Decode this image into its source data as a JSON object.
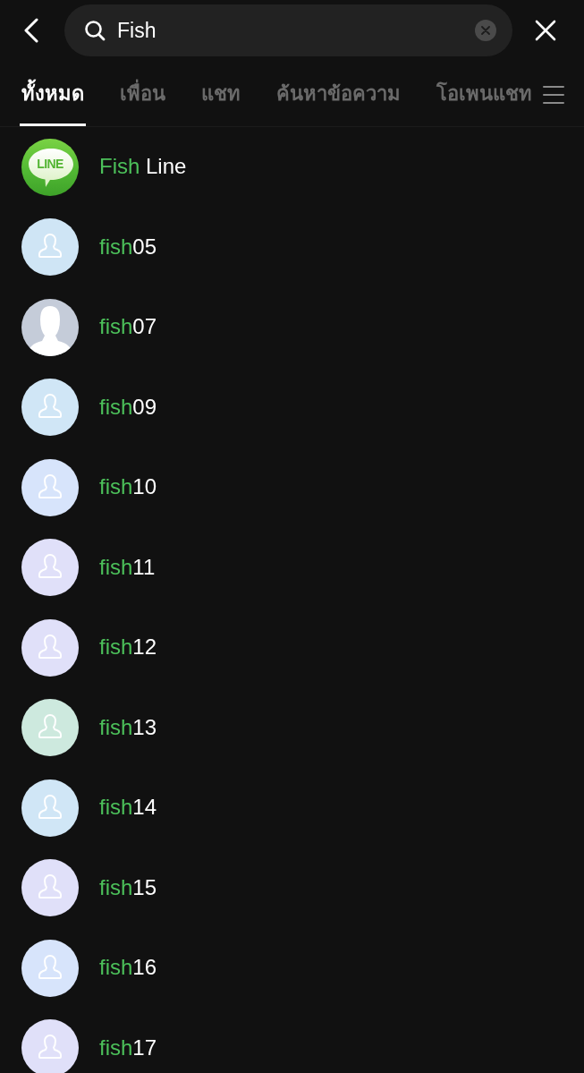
{
  "search": {
    "value": "Fish"
  },
  "tabs": [
    {
      "label": "ทั้งหมด",
      "selected": true
    },
    {
      "label": "เพื่อน",
      "selected": false
    },
    {
      "label": "แชท",
      "selected": false
    },
    {
      "label": "ค้นหาข้อความ",
      "selected": false
    },
    {
      "label": "โอเพนแชท",
      "selected": false
    }
  ],
  "results": [
    {
      "avatar": {
        "kind": "line-logo",
        "text": "LINE"
      },
      "name": [
        {
          "text": "Fish",
          "match": true
        },
        {
          "text": " Line",
          "match": false
        }
      ]
    },
    {
      "avatar": {
        "kind": "placeholder",
        "color": "#cfe5f5"
      },
      "name": [
        {
          "text": "fish",
          "match": true
        },
        {
          "text": "05",
          "match": false
        }
      ]
    },
    {
      "avatar": {
        "kind": "silhouette",
        "color": "#c5ccd9"
      },
      "name": [
        {
          "text": "fish",
          "match": true
        },
        {
          "text": "07",
          "match": false
        }
      ]
    },
    {
      "avatar": {
        "kind": "placeholder",
        "color": "#d0e6f6"
      },
      "name": [
        {
          "text": "fish",
          "match": true
        },
        {
          "text": "09",
          "match": false
        }
      ]
    },
    {
      "avatar": {
        "kind": "placeholder",
        "color": "#d7e4fb"
      },
      "name": [
        {
          "text": "fish",
          "match": true
        },
        {
          "text": "10",
          "match": false
        }
      ]
    },
    {
      "avatar": {
        "kind": "placeholder",
        "color": "#e0e0f9"
      },
      "name": [
        {
          "text": "fish",
          "match": true
        },
        {
          "text": "11",
          "match": false
        }
      ]
    },
    {
      "avatar": {
        "kind": "placeholder",
        "color": "#e0e0f9"
      },
      "name": [
        {
          "text": "fish",
          "match": true
        },
        {
          "text": "12",
          "match": false
        }
      ]
    },
    {
      "avatar": {
        "kind": "placeholder",
        "color": "#cde9de"
      },
      "name": [
        {
          "text": "fish",
          "match": true
        },
        {
          "text": "13",
          "match": false
        }
      ]
    },
    {
      "avatar": {
        "kind": "placeholder",
        "color": "#d0e6f6"
      },
      "name": [
        {
          "text": "fish",
          "match": true
        },
        {
          "text": "14",
          "match": false
        }
      ]
    },
    {
      "avatar": {
        "kind": "placeholder",
        "color": "#e0e0f9"
      },
      "name": [
        {
          "text": "fish",
          "match": true
        },
        {
          "text": "15",
          "match": false
        }
      ]
    },
    {
      "avatar": {
        "kind": "placeholder",
        "color": "#d7e4fb"
      },
      "name": [
        {
          "text": "fish",
          "match": true
        },
        {
          "text": "16",
          "match": false
        }
      ]
    },
    {
      "avatar": {
        "kind": "placeholder",
        "color": "#e0e0f9"
      },
      "name": [
        {
          "text": "fish",
          "match": true
        },
        {
          "text": "17",
          "match": false
        }
      ]
    }
  ]
}
